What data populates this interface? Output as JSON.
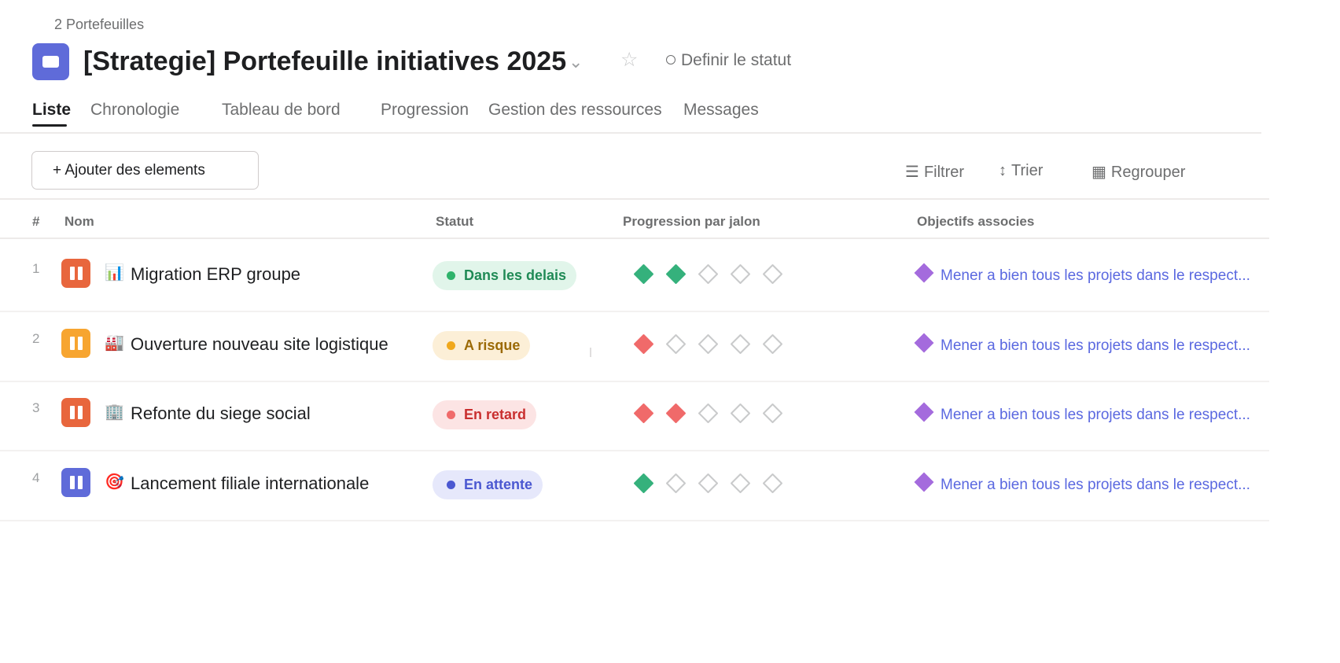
{
  "breadcrumb": "2 Portefeuilles",
  "title": "[Strategie] Portefeuille initiatives 2025",
  "header": {
    "chevron_icon": "chevron-down-icon",
    "star_icon": "star-outline-icon",
    "set_status": "Definir le statut"
  },
  "tabs": [
    "Liste",
    "Chronologie",
    "Tableau de bord",
    "Progression",
    "Gestion des ressources",
    "Messages"
  ],
  "active_tab": "Liste",
  "toolbar": {
    "add_label": "+ Ajouter des elements",
    "filter_label": "Filtrer",
    "sort_label": "Trier",
    "group_label": "Regrouper",
    "filter_icon": "☰",
    "sort_icon": "↕",
    "group_icon": "▦"
  },
  "columns": {
    "num": "#",
    "name": "Nom",
    "status": "Statut",
    "progress": "Progression par jalon",
    "goals": "Objectifs associes"
  },
  "colors": {
    "green": "#35b17c",
    "red": "#f06a6a",
    "empty": "#c9cacb",
    "goal": "#a46bdd",
    "accent": "#5f6bd9"
  },
  "rows": [
    {
      "num": "1",
      "icon_color": "#e8663d",
      "emoji": "📊",
      "name": "Migration ERP groupe",
      "status": "Dans les delais",
      "status_bg": "#e1f5ea",
      "status_fg": "#1f8a55",
      "status_dot": "#2fb36b",
      "milestones_total": 5,
      "milestones_done": 2,
      "milestone_color": "#35b17c",
      "goal": "Mener a bien tous les projets dans le respect..."
    },
    {
      "num": "2",
      "icon_color": "#f7a530",
      "emoji": "🏭",
      "name": "Ouverture nouveau site logistique",
      "status": "A risque",
      "status_bg": "#fcefd7",
      "status_fg": "#9b6a06",
      "status_dot": "#f0a81c",
      "milestones_total": 5,
      "milestones_done": 1,
      "milestone_color": "#f06a6a",
      "goal": "Mener a bien tous les projets dans le respect..."
    },
    {
      "num": "3",
      "icon_color": "#e8663d",
      "emoji": "🏢",
      "name": "Refonte du siege social",
      "status": "En retard",
      "status_bg": "#fce4e4",
      "status_fg": "#c92f2f",
      "status_dot": "#f06a6a",
      "milestones_total": 5,
      "milestones_done": 2,
      "milestone_color": "#f06a6a",
      "goal": "Mener a bien tous les projets dans le respect..."
    },
    {
      "num": "4",
      "icon_color": "#5f6bd9",
      "emoji": "🎯",
      "name": "Lancement filiale internationale",
      "status": "En attente",
      "status_bg": "#e6e8fb",
      "status_fg": "#4b58d1",
      "status_dot": "#4b58d1",
      "milestones_total": 5,
      "milestones_done": 1,
      "milestone_color": "#35b17c",
      "goal": "Mener a bien tous les projets dans le respect..."
    }
  ]
}
